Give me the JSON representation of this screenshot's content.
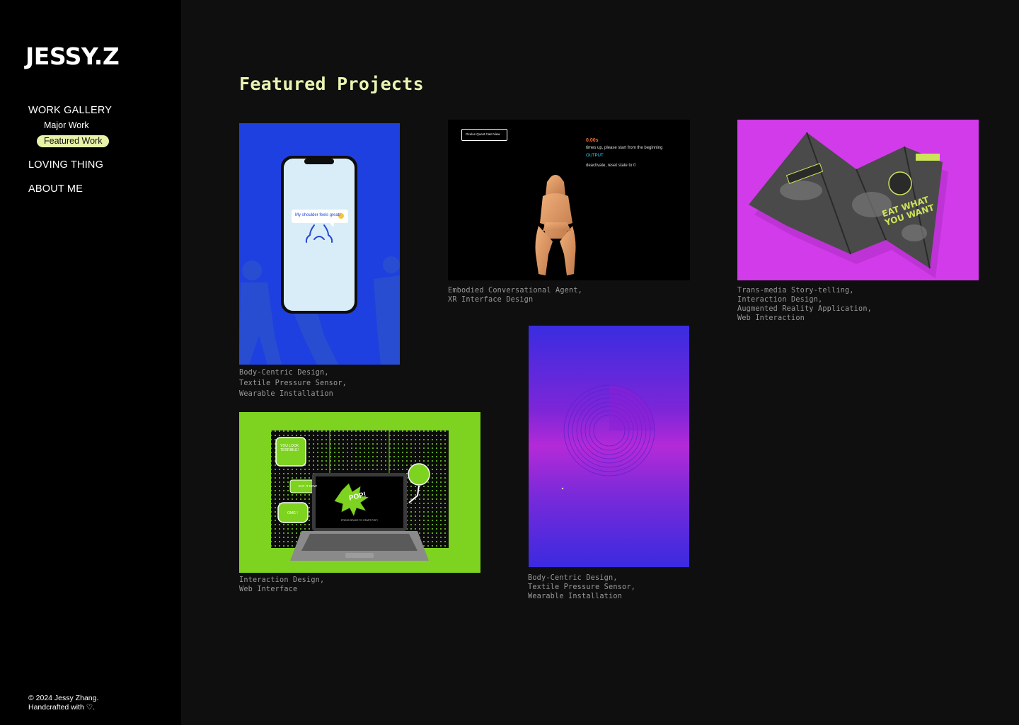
{
  "brand": "JESSY.Z",
  "nav": {
    "work_gallery": "WORK GALLERY",
    "major_work": "Major Work",
    "featured_work": "Featured Work",
    "loving_thing": "LOVING THING",
    "about_me": "ABOUT ME"
  },
  "footer": {
    "line1": "© 2024 Jessy Zhang.",
    "line2": "Handcrafted with ♡."
  },
  "main": {
    "title": "Featured Projects",
    "projects": [
      {
        "tags": [
          "Body-Centric Design,",
          "Textile Pressure Sensor,",
          "Wearable Installation"
        ],
        "bubble_text": "My shoulder feels great!",
        "bg_color": "#1f40e0"
      },
      {
        "tags": [
          "Embodied Conversational Agent,",
          "XR Interface Design"
        ],
        "screen_button": "Oculus Quest Cast View",
        "timer": "0.00s",
        "message": "times up, please start from the beginning",
        "output_label": "OUTPUT",
        "status": "deactivate, reset state to 0"
      },
      {
        "tags": [
          "Trans-media Story-telling,",
          "Interaction Design,",
          "Augmented Reality Application,",
          "Web Interaction"
        ],
        "brochure_text": "EAT WHAT YOU WANT",
        "bg_color": "#d23bea"
      },
      {
        "tags": [
          "Interaction Design,",
          "Web Interface"
        ],
        "bubble1": "YOU LOOK TERRIBLE!",
        "bubble2": "EAT IT NOW",
        "bubble3": "OMG !",
        "burst_text": "POP!",
        "screen_hint": "PRESS SPACE TO START POP!",
        "bg_color": "#7ed321"
      },
      {
        "tags": [
          "Body-Centric Design,",
          "Textile Pressure Sensor,",
          "Wearable Installation"
        ],
        "bg_color": "#6a2bdc"
      }
    ]
  }
}
